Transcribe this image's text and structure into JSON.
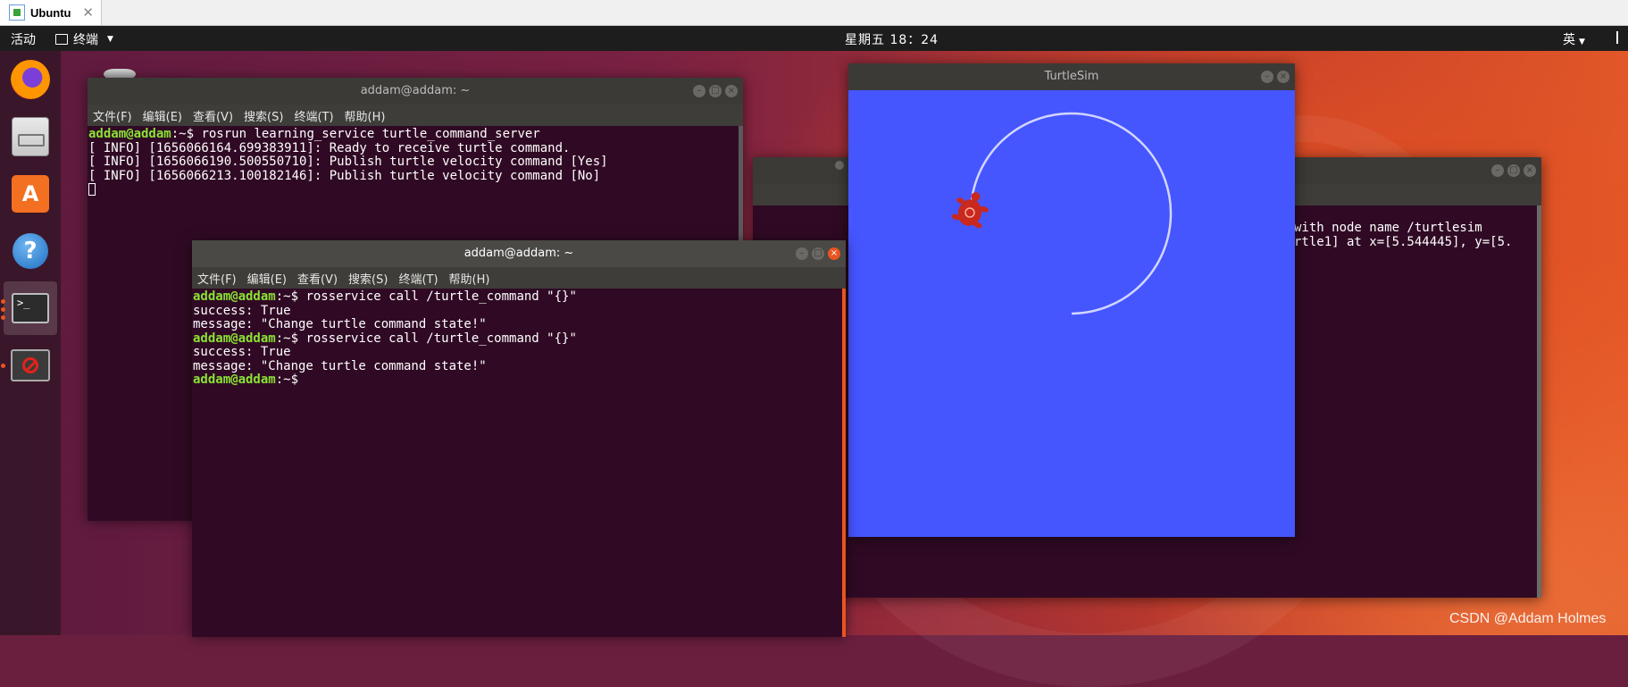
{
  "vm": {
    "tab_title": "Ubuntu",
    "close_glyph": "✕"
  },
  "panel": {
    "activities": "活动",
    "app_menu": "终端",
    "clock": "星期五 18：24",
    "input_method": "英"
  },
  "dock": {
    "items": [
      {
        "name": "firefox",
        "active": false,
        "running": false
      },
      {
        "name": "files",
        "active": false,
        "running": false
      },
      {
        "name": "ubuntu-software",
        "active": false,
        "running": false
      },
      {
        "name": "help",
        "active": false,
        "running": false
      },
      {
        "name": "terminal",
        "active": true,
        "running": true,
        "glyph": ">_"
      },
      {
        "name": "unknown-app",
        "active": false,
        "running": true
      }
    ]
  },
  "menu_labels": [
    "文件(F)",
    "编辑(E)",
    "查看(V)",
    "搜索(S)",
    "终端(T)",
    "帮助(H)"
  ],
  "server_terminal": {
    "title": "addam@addam: ~",
    "lines": [
      {
        "user": "addam@addam",
        "path": ":~$ ",
        "cmd": "rosrun learning_service turtle_command_server"
      },
      {
        "text": "[ INFO] [1656066164.699383911]: Ready to receive turtle command."
      },
      {
        "text": "[ INFO] [1656066190.500550710]: Publish turtle velocity command [Yes]"
      },
      {
        "text": "[ INFO] [1656066213.100182146]: Publish turtle velocity command [No]"
      }
    ]
  },
  "client_terminal": {
    "title": "addam@addam: ~",
    "lines": [
      {
        "user": "addam@addam",
        "path": ":~$ ",
        "cmd": "rosservice call /turtle_command \"{}\""
      },
      {
        "text": "success: True"
      },
      {
        "text": "message: \"Change turtle command state!\""
      },
      {
        "user": "addam@addam",
        "path": ":~$ ",
        "cmd": "rosservice call /turtle_command \"{}\""
      },
      {
        "text": "success: True"
      },
      {
        "text": "message: \"Change turtle command state!\""
      },
      {
        "user": "addam@addam",
        "path": ":~$",
        "cmd": ""
      }
    ]
  },
  "third_terminal": {
    "visible_lines": [
      "with node name /turtlesim",
      "rtle1] at x=[5.544445], y=[5."
    ]
  },
  "turtlesim": {
    "title": "TurtleSim",
    "background": "#4556ff",
    "path_color": "#d2d6ff",
    "turtle_color": "#c8281e"
  },
  "watermark": "CSDN @Addam Holmes",
  "colors": {
    "terminal_bg": "#300a24",
    "prompt_user": "#8ae234",
    "accent": "#e95420"
  }
}
